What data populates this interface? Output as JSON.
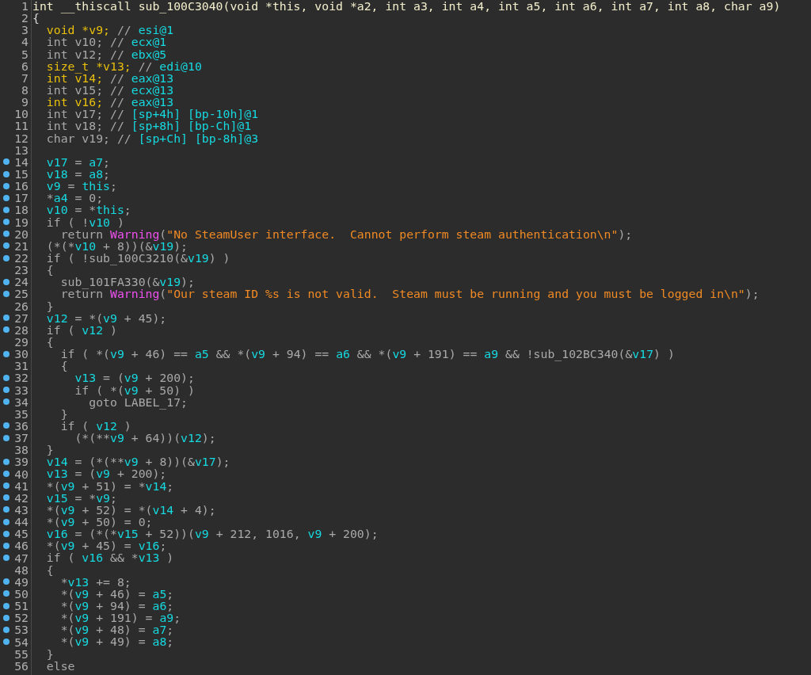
{
  "code_view": {
    "lines": [
      {
        "number": "1",
        "breakpoint": false,
        "tokens": [
          {
            "kind": "signature",
            "text": "int __thiscall sub_100C3040(void *this, void *a2, int a3, int a4, int a5, int a6, int a7, int a8, char a9)"
          }
        ]
      },
      {
        "number": "2",
        "breakpoint": false,
        "tokens": [
          {
            "kind": "brace",
            "text": "{"
          }
        ]
      },
      {
        "number": "3",
        "breakpoint": false,
        "tokens": [
          {
            "kind": "decl",
            "text": "  void *v9;"
          },
          {
            "kind": "plain",
            "text": " // "
          },
          {
            "kind": "var",
            "text": "esi@1"
          }
        ]
      },
      {
        "number": "4",
        "breakpoint": false,
        "tokens": [
          {
            "kind": "plain",
            "text": "  int v10; // "
          },
          {
            "kind": "var",
            "text": "ecx@1"
          }
        ]
      },
      {
        "number": "5",
        "breakpoint": false,
        "tokens": [
          {
            "kind": "plain",
            "text": "  int v12; // "
          },
          {
            "kind": "var",
            "text": "ebx@5"
          }
        ]
      },
      {
        "number": "6",
        "breakpoint": false,
        "tokens": [
          {
            "kind": "decl",
            "text": "  size_t *v13;"
          },
          {
            "kind": "plain",
            "text": " // "
          },
          {
            "kind": "var",
            "text": "edi@10"
          }
        ]
      },
      {
        "number": "7",
        "breakpoint": false,
        "tokens": [
          {
            "kind": "decl",
            "text": "  int v14;"
          },
          {
            "kind": "plain",
            "text": " // "
          },
          {
            "kind": "var",
            "text": "eax@13"
          }
        ]
      },
      {
        "number": "8",
        "breakpoint": false,
        "tokens": [
          {
            "kind": "plain",
            "text": "  int v15; // "
          },
          {
            "kind": "var",
            "text": "ecx@13"
          }
        ]
      },
      {
        "number": "9",
        "breakpoint": false,
        "tokens": [
          {
            "kind": "decl",
            "text": "  int v16;"
          },
          {
            "kind": "plain",
            "text": " // "
          },
          {
            "kind": "var",
            "text": "eax@13"
          }
        ]
      },
      {
        "number": "10",
        "breakpoint": false,
        "tokens": [
          {
            "kind": "plain",
            "text": "  int v17; // "
          },
          {
            "kind": "var",
            "text": "[sp+4h] [bp-10h]@1"
          }
        ]
      },
      {
        "number": "11",
        "breakpoint": false,
        "tokens": [
          {
            "kind": "plain",
            "text": "  int v18; // "
          },
          {
            "kind": "var",
            "text": "[sp+8h] [bp-Ch]@1"
          }
        ]
      },
      {
        "number": "12",
        "breakpoint": false,
        "tokens": [
          {
            "kind": "plain",
            "text": "  char v19; // "
          },
          {
            "kind": "var",
            "text": "[sp+Ch] [bp-8h]@3"
          }
        ]
      },
      {
        "number": "13",
        "breakpoint": false
      },
      {
        "number": "14",
        "breakpoint": true,
        "tokens": [
          {
            "kind": "var",
            "text": "  v17"
          },
          {
            "kind": "plain",
            "text": " = "
          },
          {
            "kind": "var",
            "text": "a7"
          },
          {
            "kind": "plain",
            "text": ";"
          }
        ]
      },
      {
        "number": "15",
        "breakpoint": true,
        "tokens": [
          {
            "kind": "var",
            "text": "  v18"
          },
          {
            "kind": "plain",
            "text": " = "
          },
          {
            "kind": "var",
            "text": "a8"
          },
          {
            "kind": "plain",
            "text": ";"
          }
        ]
      },
      {
        "number": "16",
        "breakpoint": true,
        "tokens": [
          {
            "kind": "var",
            "text": "  v9"
          },
          {
            "kind": "plain",
            "text": " = "
          },
          {
            "kind": "var",
            "text": "this"
          },
          {
            "kind": "plain",
            "text": ";"
          }
        ]
      },
      {
        "number": "17",
        "breakpoint": true,
        "tokens": [
          {
            "kind": "plain",
            "text": "  *"
          },
          {
            "kind": "var",
            "text": "a4"
          },
          {
            "kind": "plain",
            "text": " = 0;"
          }
        ]
      },
      {
        "number": "18",
        "breakpoint": true,
        "tokens": [
          {
            "kind": "var",
            "text": "  v10"
          },
          {
            "kind": "plain",
            "text": " = *"
          },
          {
            "kind": "var",
            "text": "this"
          },
          {
            "kind": "plain",
            "text": ";"
          }
        ]
      },
      {
        "number": "19",
        "breakpoint": true,
        "tokens": [
          {
            "kind": "plain",
            "text": "  if ( !"
          },
          {
            "kind": "var",
            "text": "v10"
          },
          {
            "kind": "plain",
            "text": " )"
          }
        ]
      },
      {
        "number": "20",
        "breakpoint": true,
        "tokens": [
          {
            "kind": "plain",
            "text": "    return "
          },
          {
            "kind": "call",
            "text": "Warning"
          },
          {
            "kind": "plain",
            "text": "("
          },
          {
            "kind": "string",
            "text": "\"No SteamUser interface.  Cannot perform steam authentication\\n\""
          },
          {
            "kind": "plain",
            "text": ");"
          }
        ]
      },
      {
        "number": "21",
        "breakpoint": true,
        "tokens": [
          {
            "kind": "plain",
            "text": "  (*(*"
          },
          {
            "kind": "var",
            "text": "v10"
          },
          {
            "kind": "plain",
            "text": " + 8))(&"
          },
          {
            "kind": "var",
            "text": "v19"
          },
          {
            "kind": "plain",
            "text": ");"
          }
        ]
      },
      {
        "number": "22",
        "breakpoint": true,
        "tokens": [
          {
            "kind": "plain",
            "text": "  if ( !sub_100C3210(&"
          },
          {
            "kind": "var",
            "text": "v19"
          },
          {
            "kind": "plain",
            "text": ") )"
          }
        ]
      },
      {
        "number": "23",
        "breakpoint": false,
        "tokens": [
          {
            "kind": "plain",
            "text": "  {"
          }
        ]
      },
      {
        "number": "24",
        "breakpoint": true,
        "tokens": [
          {
            "kind": "plain",
            "text": "    sub_101FA330(&"
          },
          {
            "kind": "var",
            "text": "v19"
          },
          {
            "kind": "plain",
            "text": ");"
          }
        ]
      },
      {
        "number": "25",
        "breakpoint": true,
        "tokens": [
          {
            "kind": "plain",
            "text": "    return "
          },
          {
            "kind": "call",
            "text": "Warning"
          },
          {
            "kind": "plain",
            "text": "("
          },
          {
            "kind": "string",
            "text": "\"Our steam ID %s is not valid.  Steam must be running and you must be logged in\\n\""
          },
          {
            "kind": "plain",
            "text": ");"
          }
        ]
      },
      {
        "number": "26",
        "breakpoint": false,
        "tokens": [
          {
            "kind": "plain",
            "text": "  }"
          }
        ]
      },
      {
        "number": "27",
        "breakpoint": true,
        "tokens": [
          {
            "kind": "var",
            "text": "  v12"
          },
          {
            "kind": "plain",
            "text": " = *("
          },
          {
            "kind": "var",
            "text": "v9"
          },
          {
            "kind": "plain",
            "text": " + 45);"
          }
        ]
      },
      {
        "number": "28",
        "breakpoint": true,
        "tokens": [
          {
            "kind": "plain",
            "text": "  if ( "
          },
          {
            "kind": "var",
            "text": "v12"
          },
          {
            "kind": "plain",
            "text": " )"
          }
        ]
      },
      {
        "number": "29",
        "breakpoint": false,
        "tokens": [
          {
            "kind": "plain",
            "text": "  {"
          }
        ]
      },
      {
        "number": "30",
        "breakpoint": true,
        "tokens": [
          {
            "kind": "plain",
            "text": "    if ( *("
          },
          {
            "kind": "var",
            "text": "v9"
          },
          {
            "kind": "plain",
            "text": " + 46) == "
          },
          {
            "kind": "var",
            "text": "a5"
          },
          {
            "kind": "plain",
            "text": " && *("
          },
          {
            "kind": "var",
            "text": "v9"
          },
          {
            "kind": "plain",
            "text": " + 94) == "
          },
          {
            "kind": "var",
            "text": "a6"
          },
          {
            "kind": "plain",
            "text": " && *("
          },
          {
            "kind": "var",
            "text": "v9"
          },
          {
            "kind": "plain",
            "text": " + 191) == "
          },
          {
            "kind": "var",
            "text": "a9"
          },
          {
            "kind": "plain",
            "text": " && !sub_102BC340(&"
          },
          {
            "kind": "var",
            "text": "v17"
          },
          {
            "kind": "plain",
            "text": ") )"
          }
        ]
      },
      {
        "number": "31",
        "breakpoint": false,
        "tokens": [
          {
            "kind": "plain",
            "text": "    {"
          }
        ]
      },
      {
        "number": "32",
        "breakpoint": true,
        "tokens": [
          {
            "kind": "var",
            "text": "      v13"
          },
          {
            "kind": "plain",
            "text": " = ("
          },
          {
            "kind": "var",
            "text": "v9"
          },
          {
            "kind": "plain",
            "text": " + 200);"
          }
        ]
      },
      {
        "number": "33",
        "breakpoint": true,
        "tokens": [
          {
            "kind": "plain",
            "text": "      if ( *("
          },
          {
            "kind": "var",
            "text": "v9"
          },
          {
            "kind": "plain",
            "text": " + 50) )"
          }
        ]
      },
      {
        "number": "34",
        "breakpoint": true,
        "tokens": [
          {
            "kind": "plain",
            "text": "        goto LABEL_17;"
          }
        ]
      },
      {
        "number": "35",
        "breakpoint": false,
        "tokens": [
          {
            "kind": "plain",
            "text": "    }"
          }
        ]
      },
      {
        "number": "36",
        "breakpoint": true,
        "tokens": [
          {
            "kind": "plain",
            "text": "    if ( "
          },
          {
            "kind": "var",
            "text": "v12"
          },
          {
            "kind": "plain",
            "text": " )"
          }
        ]
      },
      {
        "number": "37",
        "breakpoint": true,
        "tokens": [
          {
            "kind": "plain",
            "text": "      (*(**"
          },
          {
            "kind": "var",
            "text": "v9"
          },
          {
            "kind": "plain",
            "text": " + 64))("
          },
          {
            "kind": "var",
            "text": "v12"
          },
          {
            "kind": "plain",
            "text": ");"
          }
        ]
      },
      {
        "number": "38",
        "breakpoint": false,
        "tokens": [
          {
            "kind": "plain",
            "text": "  }"
          }
        ]
      },
      {
        "number": "39",
        "breakpoint": true,
        "tokens": [
          {
            "kind": "var",
            "text": "  v14"
          },
          {
            "kind": "plain",
            "text": " = (*(**"
          },
          {
            "kind": "var",
            "text": "v9"
          },
          {
            "kind": "plain",
            "text": " + 8))(&"
          },
          {
            "kind": "var",
            "text": "v17"
          },
          {
            "kind": "plain",
            "text": ");"
          }
        ]
      },
      {
        "number": "40",
        "breakpoint": true,
        "tokens": [
          {
            "kind": "var",
            "text": "  v13"
          },
          {
            "kind": "plain",
            "text": " = ("
          },
          {
            "kind": "var",
            "text": "v9"
          },
          {
            "kind": "plain",
            "text": " + 200);"
          }
        ]
      },
      {
        "number": "41",
        "breakpoint": true,
        "tokens": [
          {
            "kind": "plain",
            "text": "  *("
          },
          {
            "kind": "var",
            "text": "v9"
          },
          {
            "kind": "plain",
            "text": " + 51) = *"
          },
          {
            "kind": "var",
            "text": "v14"
          },
          {
            "kind": "plain",
            "text": ";"
          }
        ]
      },
      {
        "number": "42",
        "breakpoint": true,
        "tokens": [
          {
            "kind": "var",
            "text": "  v15"
          },
          {
            "kind": "plain",
            "text": " = *"
          },
          {
            "kind": "var",
            "text": "v9"
          },
          {
            "kind": "plain",
            "text": ";"
          }
        ]
      },
      {
        "number": "43",
        "breakpoint": true,
        "tokens": [
          {
            "kind": "plain",
            "text": "  *("
          },
          {
            "kind": "var",
            "text": "v9"
          },
          {
            "kind": "plain",
            "text": " + 52) = *("
          },
          {
            "kind": "var",
            "text": "v14"
          },
          {
            "kind": "plain",
            "text": " + 4);"
          }
        ]
      },
      {
        "number": "44",
        "breakpoint": true,
        "tokens": [
          {
            "kind": "plain",
            "text": "  *("
          },
          {
            "kind": "var",
            "text": "v9"
          },
          {
            "kind": "plain",
            "text": " + 50) = 0;"
          }
        ]
      },
      {
        "number": "45",
        "breakpoint": true,
        "tokens": [
          {
            "kind": "var",
            "text": "  v16"
          },
          {
            "kind": "plain",
            "text": " = (*(*"
          },
          {
            "kind": "var",
            "text": "v15"
          },
          {
            "kind": "plain",
            "text": " + 52))("
          },
          {
            "kind": "var",
            "text": "v9"
          },
          {
            "kind": "plain",
            "text": " + 212, 1016, "
          },
          {
            "kind": "var",
            "text": "v9"
          },
          {
            "kind": "plain",
            "text": " + 200);"
          }
        ]
      },
      {
        "number": "46",
        "breakpoint": true,
        "tokens": [
          {
            "kind": "plain",
            "text": "  *("
          },
          {
            "kind": "var",
            "text": "v9"
          },
          {
            "kind": "plain",
            "text": " + 45) = "
          },
          {
            "kind": "var",
            "text": "v16"
          },
          {
            "kind": "plain",
            "text": ";"
          }
        ]
      },
      {
        "number": "47",
        "breakpoint": true,
        "tokens": [
          {
            "kind": "plain",
            "text": "  if ( "
          },
          {
            "kind": "var",
            "text": "v16"
          },
          {
            "kind": "plain",
            "text": " && *"
          },
          {
            "kind": "var",
            "text": "v13"
          },
          {
            "kind": "plain",
            "text": " )"
          }
        ]
      },
      {
        "number": "48",
        "breakpoint": false,
        "tokens": [
          {
            "kind": "plain",
            "text": "  {"
          }
        ]
      },
      {
        "number": "49",
        "breakpoint": true,
        "tokens": [
          {
            "kind": "plain",
            "text": "    *"
          },
          {
            "kind": "var",
            "text": "v13"
          },
          {
            "kind": "plain",
            "text": " += 8;"
          }
        ]
      },
      {
        "number": "50",
        "breakpoint": true,
        "tokens": [
          {
            "kind": "plain",
            "text": "    *("
          },
          {
            "kind": "var",
            "text": "v9"
          },
          {
            "kind": "plain",
            "text": " + 46) = "
          },
          {
            "kind": "var",
            "text": "a5"
          },
          {
            "kind": "plain",
            "text": ";"
          }
        ]
      },
      {
        "number": "51",
        "breakpoint": true,
        "tokens": [
          {
            "kind": "plain",
            "text": "    *("
          },
          {
            "kind": "var",
            "text": "v9"
          },
          {
            "kind": "plain",
            "text": " + 94) = "
          },
          {
            "kind": "var",
            "text": "a6"
          },
          {
            "kind": "plain",
            "text": ";"
          }
        ]
      },
      {
        "number": "52",
        "breakpoint": true,
        "tokens": [
          {
            "kind": "plain",
            "text": "    *("
          },
          {
            "kind": "var",
            "text": "v9"
          },
          {
            "kind": "plain",
            "text": " + 191) = "
          },
          {
            "kind": "var",
            "text": "a9"
          },
          {
            "kind": "plain",
            "text": ";"
          }
        ]
      },
      {
        "number": "53",
        "breakpoint": true,
        "tokens": [
          {
            "kind": "plain",
            "text": "    *("
          },
          {
            "kind": "var",
            "text": "v9"
          },
          {
            "kind": "plain",
            "text": " + 48) = "
          },
          {
            "kind": "var",
            "text": "a7"
          },
          {
            "kind": "plain",
            "text": ";"
          }
        ]
      },
      {
        "number": "54",
        "breakpoint": true,
        "tokens": [
          {
            "kind": "plain",
            "text": "    *("
          },
          {
            "kind": "var",
            "text": "v9"
          },
          {
            "kind": "plain",
            "text": " + 49) = "
          },
          {
            "kind": "var",
            "text": "a8"
          },
          {
            "kind": "plain",
            "text": ";"
          }
        ]
      },
      {
        "number": "55",
        "breakpoint": false,
        "tokens": [
          {
            "kind": "plain",
            "text": "  }"
          }
        ]
      },
      {
        "number": "56",
        "breakpoint": false,
        "tokens": [
          {
            "kind": "plain",
            "text": "  else"
          }
        ]
      }
    ]
  }
}
